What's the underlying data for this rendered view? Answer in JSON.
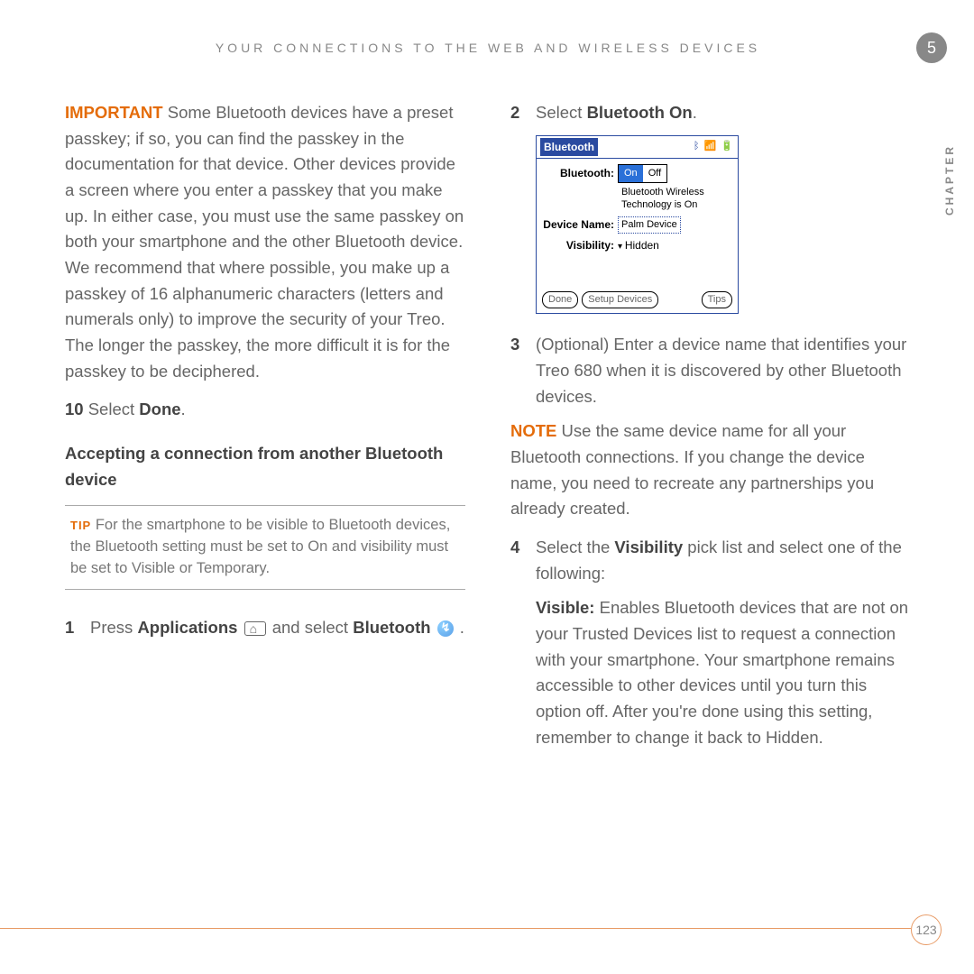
{
  "header": "YOUR CONNECTIONS TO THE WEB AND WIRELESS DEVICES",
  "chapter_number": "5",
  "chapter_label": "CHAPTER",
  "page_number": "123",
  "left": {
    "important_label": "IMPORTANT",
    "important_text": "Some Bluetooth devices have a preset passkey; if so, you can find the passkey in the documentation for that device. Other devices provide a screen where you enter a passkey that you make up. In either case, you must use the same passkey on both your smartphone and the other Bluetooth device. We recommend that where possible, you make up a passkey of 16 alphanumeric characters (letters and numerals only) to improve the security of your Treo. The longer the passkey, the more difficult it is for the passkey to be deciphered.",
    "step10_num": "10",
    "step10_a": " Select ",
    "step10_b": "Done",
    "step10_c": ".",
    "subheading": "Accepting a connection from another Bluetooth device",
    "tip_label": "TIP",
    "tip_text": " For the smartphone to be visible to Bluetooth devices, the Bluetooth setting must be set to On and visibility must be set to Visible or Temporary.",
    "step1_num": "1",
    "step1_a": "Press ",
    "step1_b": "Applications",
    "step1_c": " and select ",
    "step1_d": "Bluetooth",
    "step1_e": " ."
  },
  "right": {
    "step2_num": "2",
    "step2_a": "Select ",
    "step2_b": "Bluetooth On",
    "step2_c": ".",
    "step3_num": "3",
    "step3_text": "(Optional)  Enter a device name that identifies your Treo 680 when it is discovered by other Bluetooth devices.",
    "note_label": "NOTE",
    "note_text": " Use the same device name for all your Bluetooth connections. If you change the device name, you need to recreate any partnerships you already created.",
    "step4_num": "4",
    "step4_a": "Select the ",
    "step4_b": "Visibility",
    "step4_c": " pick list and select one of the following:",
    "visible_label": "Visible:",
    "visible_text": " Enables Bluetooth devices that are not on your Trusted Devices list to request a connection with your smartphone. Your smartphone remains accessible to other devices until you turn this option off. After you're done using this setting, remember to change it back to Hidden."
  },
  "screenshot": {
    "title": "Bluetooth",
    "row_bt": "Bluetooth:",
    "on": "On",
    "off": "Off",
    "status1": "Bluetooth Wireless",
    "status2": "Technology is On",
    "row_name": "Device Name:",
    "name_value": "Palm Device",
    "row_vis": "Visibility:",
    "vis_value": "Hidden",
    "btn_done": "Done",
    "btn_setup": "Setup Devices",
    "btn_tips": "Tips"
  }
}
